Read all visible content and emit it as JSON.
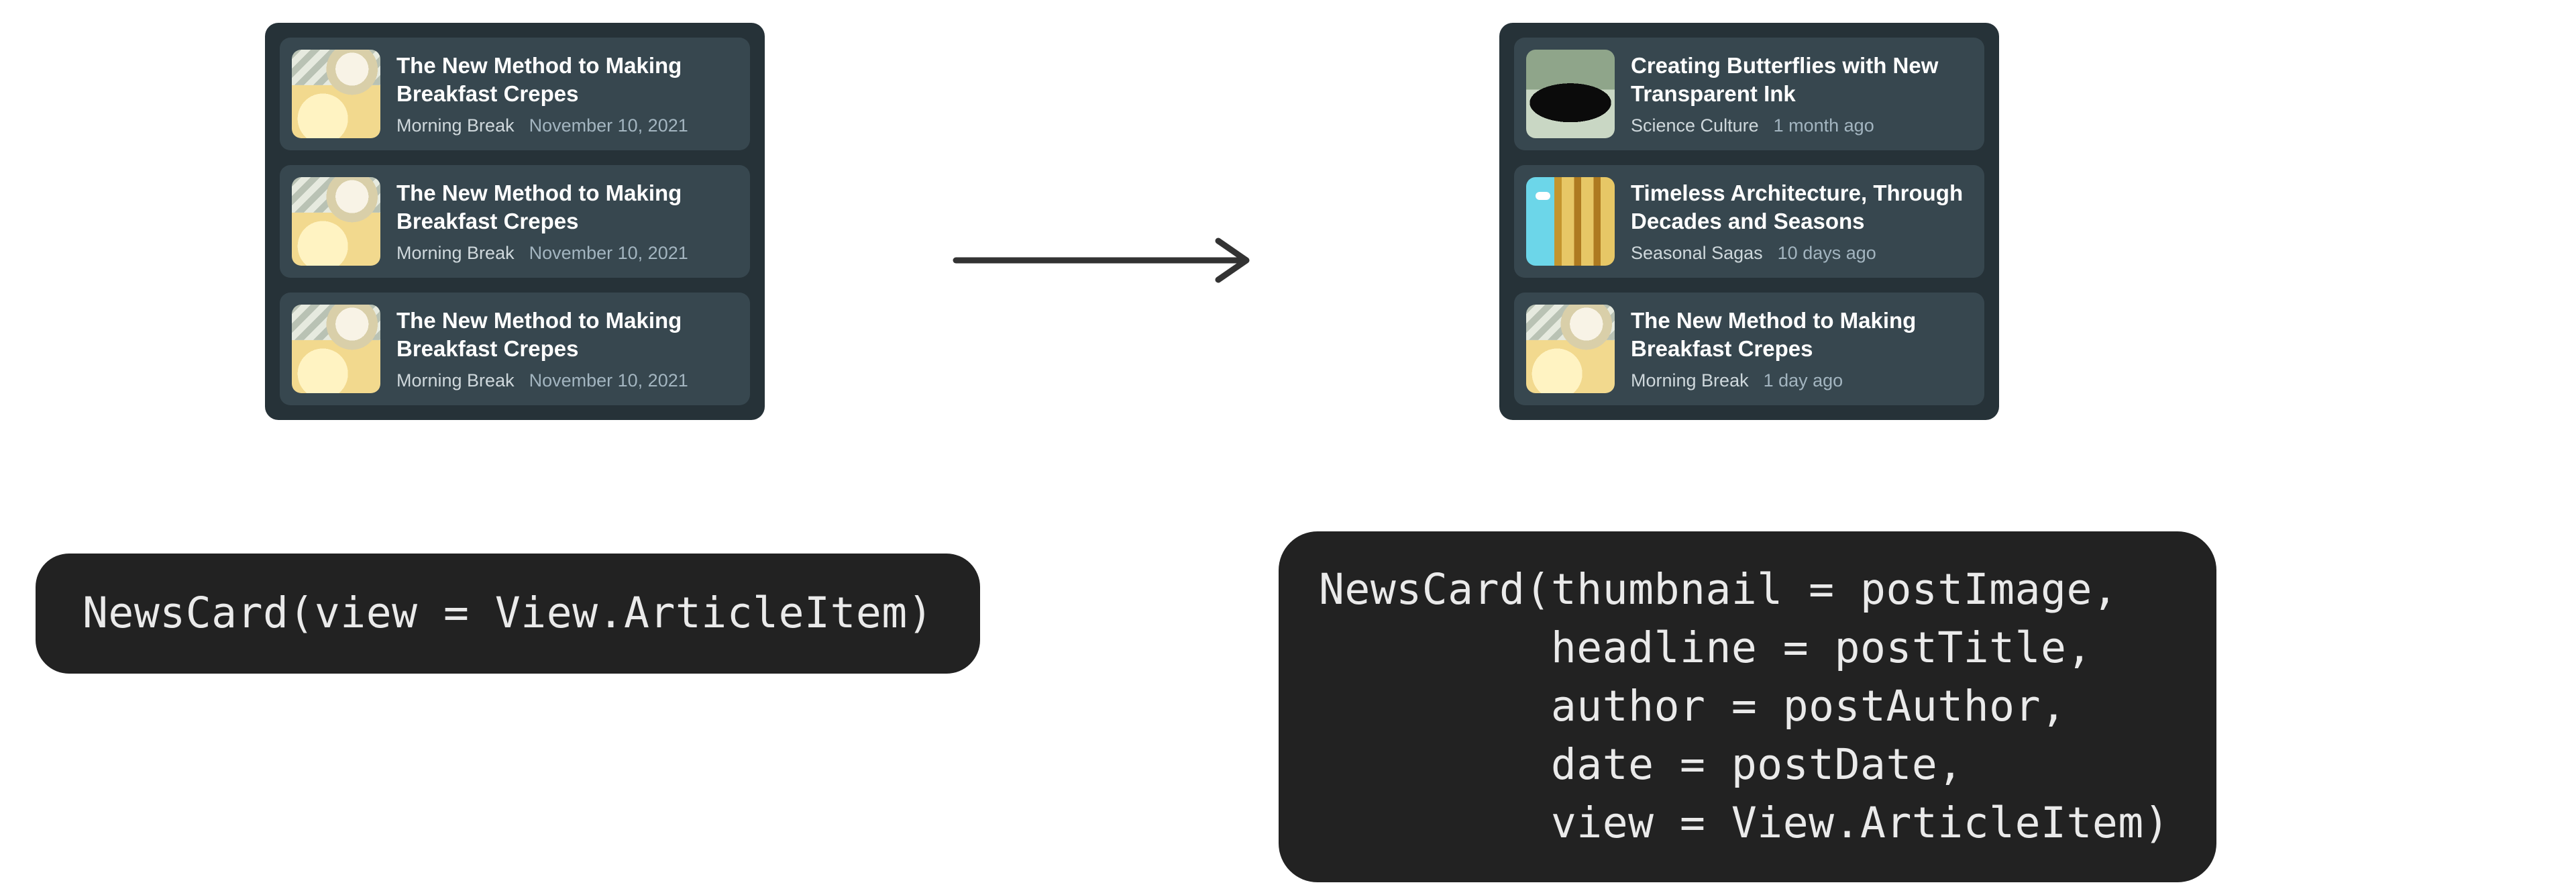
{
  "left_panel": {
    "items": [
      {
        "title": "The New Method to Making Breakfast Crepes",
        "author": "Morning Break",
        "date": "November 10, 2021",
        "thumb": "crepes"
      },
      {
        "title": "The New Method to Making Breakfast Crepes",
        "author": "Morning Break",
        "date": "November 10, 2021",
        "thumb": "crepes"
      },
      {
        "title": "The New Method to Making Breakfast Crepes",
        "author": "Morning Break",
        "date": "November 10, 2021",
        "thumb": "crepes"
      }
    ]
  },
  "right_panel": {
    "items": [
      {
        "title": "Creating Butterflies with New Transparent Ink",
        "author": "Science Culture",
        "date": "1 month ago",
        "thumb": "butterfly"
      },
      {
        "title": "Timeless Architecture, Through Decades and Seasons",
        "author": "Seasonal Sagas",
        "date": "10 days ago",
        "thumb": "arch"
      },
      {
        "title": "The New Method to Making Breakfast Crepes",
        "author": "Morning Break",
        "date": "1 day ago",
        "thumb": "crepes"
      }
    ]
  },
  "code_left": "NewsCard(view = View.ArticleItem)",
  "code_right": "NewsCard(thumbnail = postImage,\n         headline = postTitle,\n         author = postAuthor,\n         date = postDate,\n         view = View.ArticleItem)"
}
